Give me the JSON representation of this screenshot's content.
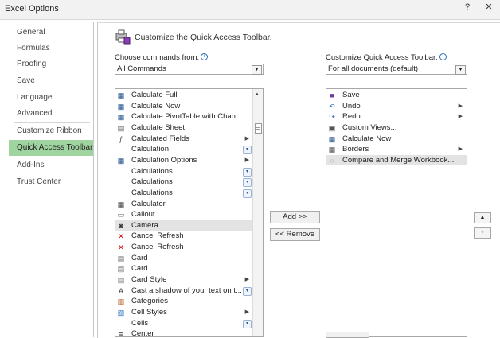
{
  "window": {
    "title": "Excel Options",
    "help": "?",
    "close": "✕"
  },
  "sidebar": {
    "items": [
      {
        "label": "General"
      },
      {
        "label": "Formulas"
      },
      {
        "label": "Proofing"
      },
      {
        "label": "Save"
      },
      {
        "label": "Language"
      },
      {
        "label": "Advanced"
      },
      {
        "label": "Customize Ribbon"
      },
      {
        "label": "Quick Access Toolbar",
        "active": true
      },
      {
        "label": "Add-Ins"
      },
      {
        "label": "Trust Center"
      }
    ]
  },
  "main": {
    "header": "Customize the Quick Access Toolbar.",
    "choose_label": "Choose commands from:",
    "choose_value": "All Commands",
    "customize_label": "Customize Quick Access Toolbar:",
    "customize_value": "For all documents (default)",
    "add_button": "Add >>",
    "remove_button": "<< Remove",
    "commands": [
      {
        "label": "Calculate Full",
        "icon": "calc-icon"
      },
      {
        "label": "Calculate Now",
        "icon": "calc-icon"
      },
      {
        "label": "Calculate PivotTable with Chan...",
        "icon": "calc-icon"
      },
      {
        "label": "Calculate Sheet",
        "icon": "sheet-calc-icon"
      },
      {
        "label": "Calculated Fields",
        "icon": "fx-icon",
        "submenu": true
      },
      {
        "label": "Calculation",
        "dropdown": true
      },
      {
        "label": "Calculation Options",
        "icon": "calc-icon",
        "submenu": true
      },
      {
        "label": "Calculations",
        "dropdown": true
      },
      {
        "label": "Calculations",
        "dropdown": true
      },
      {
        "label": "Calculations",
        "dropdown": true
      },
      {
        "label": "Calculator",
        "icon": "calculator-icon"
      },
      {
        "label": "Callout",
        "icon": "callout-icon"
      },
      {
        "label": "Camera",
        "icon": "camera-icon",
        "selected": true
      },
      {
        "label": "Cancel Refresh",
        "icon": "cancel-refresh-icon"
      },
      {
        "label": "Cancel Refresh",
        "icon": "cancel-refresh-icon"
      },
      {
        "label": "Card",
        "icon": "card-icon"
      },
      {
        "label": "Card",
        "icon": "card-icon"
      },
      {
        "label": "Card Style",
        "icon": "card-icon",
        "submenu": true
      },
      {
        "label": "Cast a shadow of your text on t...",
        "icon": "text-effect-icon",
        "dropdown": true
      },
      {
        "label": "Categories",
        "icon": "categories-icon"
      },
      {
        "label": "Cell Styles",
        "icon": "cell-styles-icon",
        "submenu": true
      },
      {
        "label": "Cells",
        "dropdown": true
      },
      {
        "label": "Center",
        "icon": "center-icon"
      }
    ],
    "toolbar_items": [
      {
        "label": "Save",
        "icon": "save-icon"
      },
      {
        "label": "Undo",
        "icon": "undo-icon",
        "submenu": true
      },
      {
        "label": "Redo",
        "icon": "redo-icon",
        "submenu": true
      },
      {
        "label": "Custom Views...",
        "icon": "custom-views-icon"
      },
      {
        "label": "Calculate Now",
        "icon": "calc-icon"
      },
      {
        "label": "Borders",
        "icon": "borders-icon",
        "submenu": true
      },
      {
        "label": "Compare and Merge Workbook...",
        "icon": "compare-merge-icon",
        "selected": true
      }
    ]
  }
}
